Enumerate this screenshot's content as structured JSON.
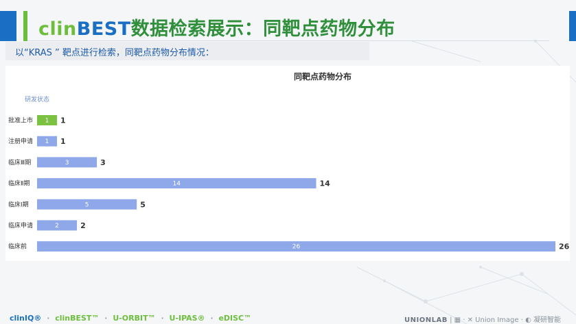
{
  "header": {
    "title_brand_prefix": "clin",
    "title_brand_main": "BEST",
    "title_rest": "数据检索展示：同靶点药物分布",
    "subtitle": "以“KRAS ” 靶点进行检索，同靶点药物分布情况："
  },
  "colors": {
    "green": "#7cc242",
    "blue": "#8ea8ea",
    "accent_blue": "#1a6fc4",
    "accent_green": "#6dbe3c"
  },
  "chart_data": {
    "type": "bar",
    "orientation": "horizontal",
    "title": "同靶点药物分布",
    "legend": [
      "研发状态"
    ],
    "legend_position": "top-left",
    "categories": [
      "批准上市",
      "注册申请",
      "临床Ⅲ期",
      "临床Ⅱ期",
      "临床Ⅰ期",
      "临床申请",
      "临床前"
    ],
    "values": [
      1,
      1,
      3,
      14,
      5,
      2,
      26
    ],
    "bar_colors": [
      "#7cc242",
      "#8ea8ea",
      "#8ea8ea",
      "#8ea8ea",
      "#8ea8ea",
      "#8ea8ea",
      "#8ea8ea"
    ],
    "xlim": [
      0,
      26
    ],
    "grid": false
  },
  "footer": {
    "left_items": [
      "clinIQ®",
      "clinBEST™",
      "U-ORBIT™",
      "U-IPAS®",
      "eDISC™"
    ],
    "right_items": [
      "UNIONLAB",
      "Union Image",
      "凝研智能"
    ]
  }
}
